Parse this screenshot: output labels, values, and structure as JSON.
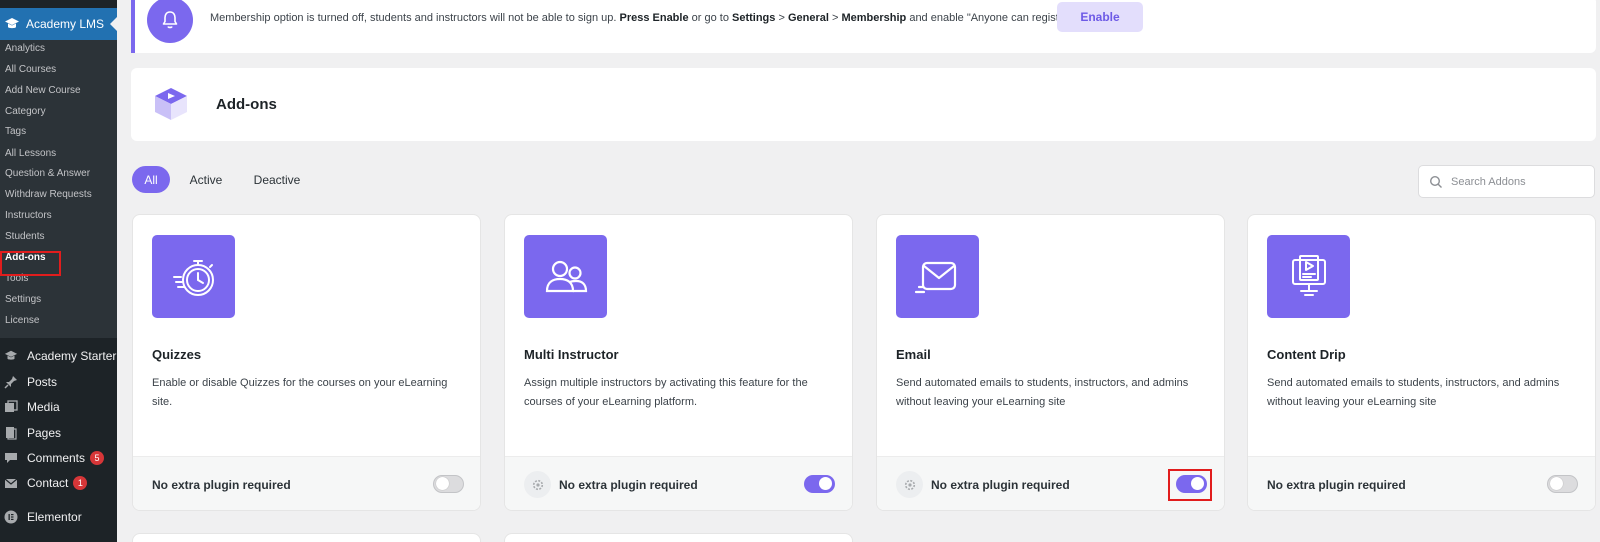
{
  "sidebar": {
    "active_menu": "Academy LMS",
    "submenu": [
      {
        "label": "Analytics",
        "current": false
      },
      {
        "label": "All Courses",
        "current": false
      },
      {
        "label": "Add New Course",
        "current": false
      },
      {
        "label": "Category",
        "current": false
      },
      {
        "label": "Tags",
        "current": false
      },
      {
        "label": "All Lessons",
        "current": false
      },
      {
        "label": "Question & Answer",
        "current": false
      },
      {
        "label": "Withdraw Requests",
        "current": false
      },
      {
        "label": "Instructors",
        "current": false
      },
      {
        "label": "Students",
        "current": false
      },
      {
        "label": "Add-ons",
        "current": true
      },
      {
        "label": "Tools",
        "current": false
      },
      {
        "label": "Settings",
        "current": false
      },
      {
        "label": "License",
        "current": false
      }
    ],
    "menu": [
      {
        "label": "Academy Starter",
        "icon": "graduation-cap-icon"
      },
      {
        "label": "Posts",
        "icon": "pin-icon"
      },
      {
        "label": "Media",
        "icon": "media-icon"
      },
      {
        "label": "Pages",
        "icon": "pages-icon"
      },
      {
        "label": "Comments",
        "icon": "comment-icon",
        "badge": "5"
      },
      {
        "label": "Contact",
        "icon": "mail-icon",
        "badge": "1"
      },
      {
        "label": "Elementor",
        "icon": "elementor-icon"
      }
    ]
  },
  "notice": {
    "text_pre": "Membership option is turned off, students and instructors will not be able to sign up. ",
    "press_enable": "Press Enable",
    "text_mid": " or go to ",
    "settings": "Settings",
    "sep1": " > ",
    "general": "General",
    "sep2": " > ",
    "membership": "Membership",
    "text_post": " and enable \"Anyone can register\".",
    "button": "Enable"
  },
  "header": {
    "title": "Add-ons"
  },
  "filters": {
    "tabs": [
      {
        "label": "All",
        "active": true
      },
      {
        "label": "Active",
        "active": false
      },
      {
        "label": "Deactive",
        "active": false
      }
    ],
    "search_placeholder": "Search Addons"
  },
  "addons": [
    {
      "title": "Quizzes",
      "description": "Enable or disable Quizzes for the courses on your eLearning site.",
      "requirement": "No extra plugin required",
      "enabled": false,
      "icon": "stopwatch-icon",
      "show_gear": false
    },
    {
      "title": "Multi Instructor",
      "description": "Assign multiple instructors by activating this feature for the courses of your eLearning platform.",
      "requirement": "No extra plugin required",
      "enabled": true,
      "icon": "users-icon",
      "show_gear": true
    },
    {
      "title": "Email",
      "description": "Send automated emails to students, instructors, and admins without leaving your eLearning site",
      "requirement": "No extra plugin required",
      "enabled": true,
      "icon": "envelope-icon",
      "show_gear": true
    },
    {
      "title": "Content Drip",
      "description": "Send automated emails to students, instructors, and admins without leaving your eLearning site",
      "requirement": "No extra plugin required",
      "enabled": false,
      "icon": "content-drip-icon",
      "show_gear": false
    }
  ],
  "colors": {
    "accent": "#7b68ee",
    "sidebar": "#1d2327",
    "wp_blue": "#2271b1",
    "highlight_red": "#e11d1d"
  }
}
